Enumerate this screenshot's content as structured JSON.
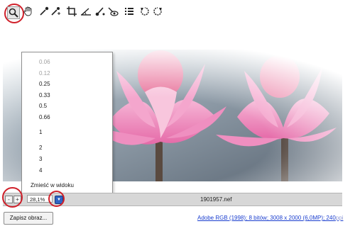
{
  "toolbar": {
    "tools": [
      {
        "name": "zoom-tool",
        "icon": "magnifier-icon"
      },
      {
        "name": "hand-tool",
        "icon": "hand-icon"
      },
      {
        "name": "eyedropper-tool",
        "icon": "eyedropper-icon"
      },
      {
        "name": "white-balance-tool",
        "icon": "eyedropper-plus-icon"
      },
      {
        "name": "crop-tool",
        "icon": "crop-icon"
      },
      {
        "name": "straighten-tool",
        "icon": "straighten-icon"
      },
      {
        "name": "red-eye-tool",
        "icon": "brush-icon"
      },
      {
        "name": "retouch-tool",
        "icon": "eye-icon"
      },
      {
        "name": "list-tool",
        "icon": "list-icon"
      },
      {
        "name": "rotate-left-tool",
        "icon": "rotate-left-icon"
      },
      {
        "name": "rotate-right-tool",
        "icon": "rotate-right-icon"
      }
    ]
  },
  "zoom_menu": {
    "options": [
      {
        "label": "0.06",
        "enabled": false
      },
      {
        "label": "0.12",
        "enabled": false
      },
      {
        "label": "0.25",
        "enabled": true
      },
      {
        "label": "0.33",
        "enabled": true
      },
      {
        "label": "0.5",
        "enabled": true
      },
      {
        "label": "0.66",
        "enabled": true
      },
      {
        "label": "1",
        "enabled": true
      },
      {
        "label": "2",
        "enabled": true
      },
      {
        "label": "3",
        "enabled": true
      },
      {
        "label": "4",
        "enabled": true
      }
    ],
    "fit_label": "Zmieść w widoku"
  },
  "statusbar": {
    "zoom_value": "28,1%",
    "filename": "1901957.nef",
    "minus_label": "-",
    "plus_label": "+"
  },
  "footer": {
    "save_label": "Zapisz obraz...",
    "info_text": "Adobe RGB (1998); 8 bitów; 3008 x 2000 (6,0MP); 240",
    "info_fade": "ppi"
  },
  "colors": {
    "highlight": "#d0202a",
    "link": "#1a3ecf",
    "petal": "#ee8fbf"
  }
}
